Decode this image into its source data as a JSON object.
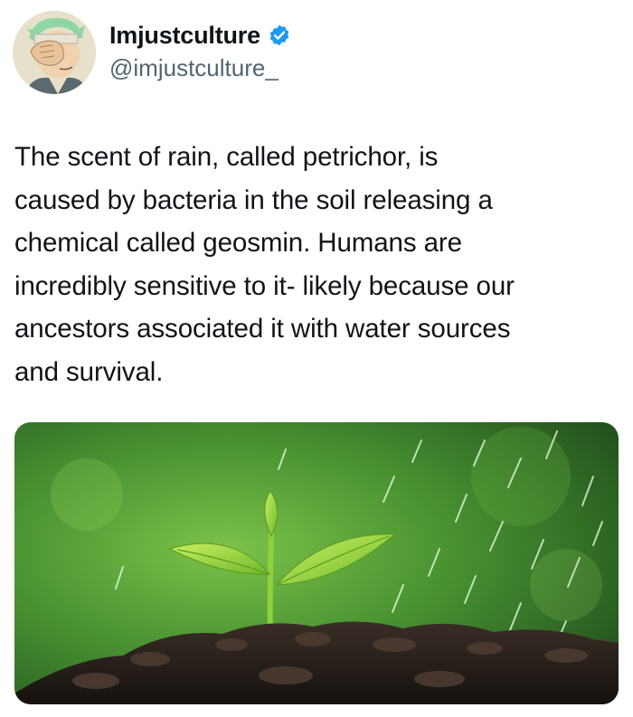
{
  "tweet": {
    "display_name": "Imjustculture",
    "handle": "@imjustculture_",
    "verified_icon": "verified-badge-icon",
    "avatar_icon": "avatar-facepalm-character",
    "text": "The scent of rain, called petrichor, is\ncaused by bacteria in the soil releasing a\nchemical called geosmin. Humans are\nincredibly sensitive to it- likely because our\nancestors associated it with water sources\nand survival.",
    "media": {
      "subject": "green seedling sprouting from dark soil in the rain",
      "colors": {
        "background": "#3f8a2b",
        "leaf": "#9bd83a",
        "soil": "#2a211c"
      }
    }
  },
  "colors": {
    "text": "#0f1419",
    "secondary_text": "#536471",
    "verified": "#1d9bf0"
  }
}
